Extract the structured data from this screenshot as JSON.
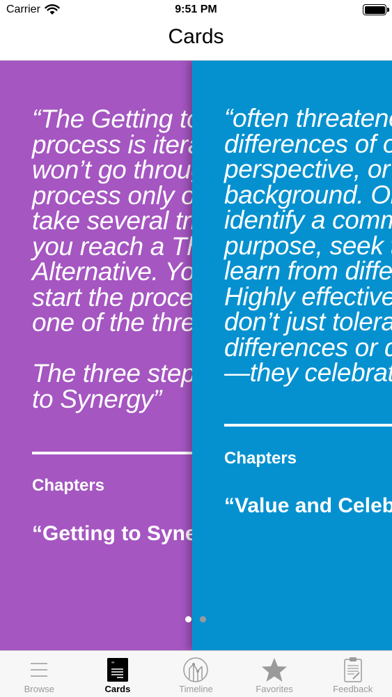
{
  "status_bar": {
    "carrier": "Carrier",
    "time": "9:51 PM"
  },
  "nav": {
    "title": "Cards"
  },
  "cards": [
    {
      "color": "#a556c1",
      "quote": "“The Getting to Synergy\nprocess is iterative. You\nwon’t go through the\nprocess only once. It may\ntake several tries before\nyou reach a Third\nAlternative. You may\nstart the process at any\none of the three steps.\n\nThe three steps\nto Synergy”",
      "section_label": "Chapters",
      "chapter": "“Getting to Synergy”"
    },
    {
      "color": "#0591cf",
      "quote": "“often threatened by\ndifferences of opinion,\nperspective, or\nbackground. Once you\nidentify a common\npurpose, seek to\nlearn from differences.\nHighly effective people\ndon’t just tolerate\ndifferences or diversity\n—they celebrate it.”",
      "section_label": "Chapters",
      "chapter": "“Value and Celebrate Differences”"
    }
  ],
  "pager": {
    "active_index": 0,
    "count": 2
  },
  "tabs": [
    {
      "label": "Browse",
      "icon": "browse-lines-icon",
      "active": false
    },
    {
      "label": "Cards",
      "icon": "cards-icon",
      "active": true
    },
    {
      "label": "Timeline",
      "icon": "timeline-icon",
      "active": false
    },
    {
      "label": "Favorites",
      "icon": "star-icon",
      "active": false
    },
    {
      "label": "Feedback",
      "icon": "clipboard-icon",
      "active": false
    }
  ],
  "colors": {
    "tab_inactive": "#9a9a9a",
    "tab_active": "#000000"
  }
}
